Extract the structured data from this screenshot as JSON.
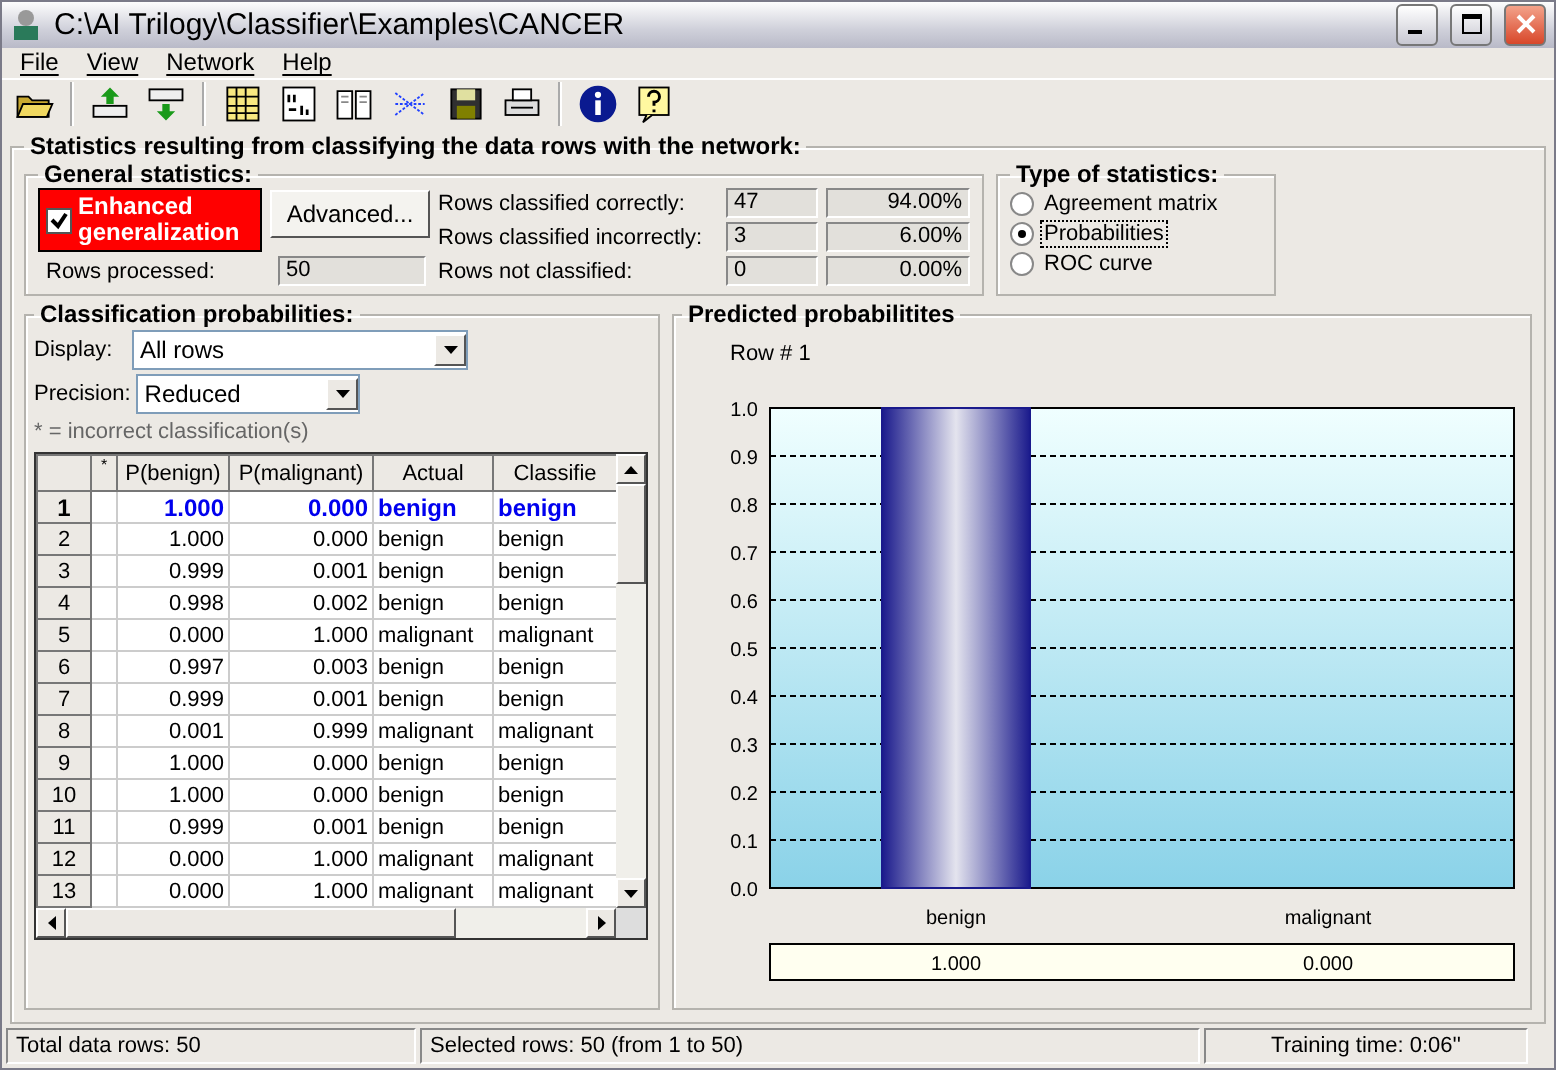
{
  "window": {
    "title": "C:\\AI Trilogy\\Classifier\\Examples\\CANCER"
  },
  "menu": [
    "File",
    "View",
    "Network",
    "Help"
  ],
  "main_group": {
    "title": "Statistics resulting from classifying the data rows with the network:"
  },
  "general": {
    "title": "General statistics:",
    "enhanced": {
      "label": "Enhanced generalization",
      "checked": true
    },
    "advanced": "Advanced...",
    "rows_processed_label": "Rows processed:",
    "rows_processed": "50",
    "stats": [
      {
        "label": "Rows classified correctly:",
        "count": "47",
        "percent": "94.00%"
      },
      {
        "label": "Rows classified incorrectly:",
        "count": "3",
        "percent": "6.00%"
      },
      {
        "label": "Rows not classified:",
        "count": "0",
        "percent": "0.00%"
      }
    ]
  },
  "type_of_statistics": {
    "title": "Type of statistics:",
    "options": [
      {
        "label": "Agreement matrix",
        "selected": false
      },
      {
        "label": "Probabilities",
        "selected": true
      },
      {
        "label": "ROC curve",
        "selected": false
      }
    ]
  },
  "classification": {
    "title": "Classification probabilities:",
    "display_label": "Display:",
    "display": "All rows",
    "precision_label": "Precision:",
    "precision": "Reduced",
    "note": "* = incorrect classification(s)",
    "columns": [
      "*",
      "P(benign)",
      "P(malignant)",
      "Actual",
      "Classifie"
    ],
    "rows": [
      {
        "n": "1",
        "p_benign": "1.000",
        "p_malignant": "0.000",
        "actual": "benign",
        "classified": "benign",
        "selected": true
      },
      {
        "n": "2",
        "p_benign": "1.000",
        "p_malignant": "0.000",
        "actual": "benign",
        "classified": "benign",
        "selected": false
      },
      {
        "n": "3",
        "p_benign": "0.999",
        "p_malignant": "0.001",
        "actual": "benign",
        "classified": "benign",
        "selected": false
      },
      {
        "n": "4",
        "p_benign": "0.998",
        "p_malignant": "0.002",
        "actual": "benign",
        "classified": "benign",
        "selected": false
      },
      {
        "n": "5",
        "p_benign": "0.000",
        "p_malignant": "1.000",
        "actual": "malignant",
        "classified": "malignant",
        "selected": false
      },
      {
        "n": "6",
        "p_benign": "0.997",
        "p_malignant": "0.003",
        "actual": "benign",
        "classified": "benign",
        "selected": false
      },
      {
        "n": "7",
        "p_benign": "0.999",
        "p_malignant": "0.001",
        "actual": "benign",
        "classified": "benign",
        "selected": false
      },
      {
        "n": "8",
        "p_benign": "0.001",
        "p_malignant": "0.999",
        "actual": "malignant",
        "classified": "malignant",
        "selected": false
      },
      {
        "n": "9",
        "p_benign": "1.000",
        "p_malignant": "0.000",
        "actual": "benign",
        "classified": "benign",
        "selected": false
      },
      {
        "n": "10",
        "p_benign": "1.000",
        "p_malignant": "0.000",
        "actual": "benign",
        "classified": "benign",
        "selected": false
      },
      {
        "n": "11",
        "p_benign": "0.999",
        "p_malignant": "0.001",
        "actual": "benign",
        "classified": "benign",
        "selected": false
      },
      {
        "n": "12",
        "p_benign": "0.000",
        "p_malignant": "1.000",
        "actual": "malignant",
        "classified": "malignant",
        "selected": false
      },
      {
        "n": "13",
        "p_benign": "0.000",
        "p_malignant": "1.000",
        "actual": "malignant",
        "classified": "malignant",
        "selected": false
      }
    ]
  },
  "predicted": {
    "title": "Predicted probabilitites",
    "chart_data": {
      "type": "bar",
      "title": "Row # 1",
      "categories": [
        "benign",
        "malignant"
      ],
      "values": [
        1.0,
        0.0
      ],
      "grid": true,
      "ylim": [
        0,
        1
      ],
      "yticks": [
        {
          "value": 0,
          "label": "0.0"
        },
        {
          "value": 0.1,
          "label": "0.1"
        },
        {
          "value": 0.2,
          "label": "0.2"
        },
        {
          "value": 0.3,
          "label": "0.3"
        },
        {
          "value": 0.4,
          "label": "0.4"
        },
        {
          "value": 0.5,
          "label": "0.5"
        },
        {
          "value": 0.6,
          "label": "0.6"
        },
        {
          "value": 0.7,
          "label": "0.7"
        },
        {
          "value": 0.8,
          "label": "0.8"
        },
        {
          "value": 0.9,
          "label": "0.9"
        },
        {
          "value": 1,
          "label": "1.0"
        }
      ],
      "value_labels": [
        "1.000",
        "0.000"
      ]
    }
  },
  "status_bar": [
    "Total data rows: 50",
    "Selected rows: 50  (from 1 to 50)",
    "Training time: 0:06''"
  ]
}
